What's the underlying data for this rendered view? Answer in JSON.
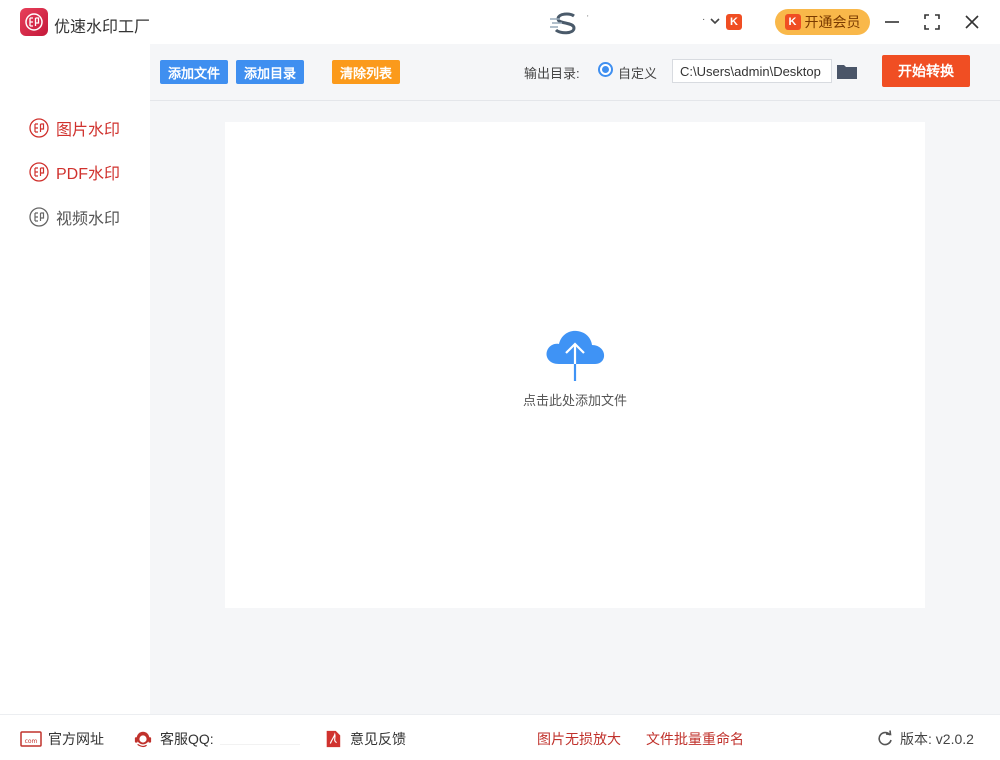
{
  "titlebar": {
    "app_title": "优速水印工厂",
    "account_text": "·",
    "vip_label": "开通会员",
    "k_letter": "K"
  },
  "sidebar": {
    "items": [
      {
        "label": "图片水印"
      },
      {
        "label": "PDF水印"
      },
      {
        "label": "视频水印"
      }
    ]
  },
  "toolbar": {
    "add_file": "添加文件",
    "add_dir": "添加目录",
    "clear_list": "清除列表",
    "output_label": "输出目录:",
    "custom_label": "自定义",
    "path_value": "C:\\Users\\admin\\Desktop",
    "start": "开始转换"
  },
  "dropzone": {
    "hint": "点击此处添加文件"
  },
  "footer": {
    "website": "官方网址",
    "qq": "客服QQ:",
    "feedback": "意见反馈",
    "link1": "图片无损放大",
    "link2": "文件批量重命名",
    "version": "版本: v2.0.2"
  },
  "colors": {
    "accent_blue": "#3f8ff0",
    "accent_orange": "#fb9a1b",
    "start_red": "#f04e23",
    "sidebar_red": "#d0322e",
    "vip_gold": "#f9b84a"
  }
}
